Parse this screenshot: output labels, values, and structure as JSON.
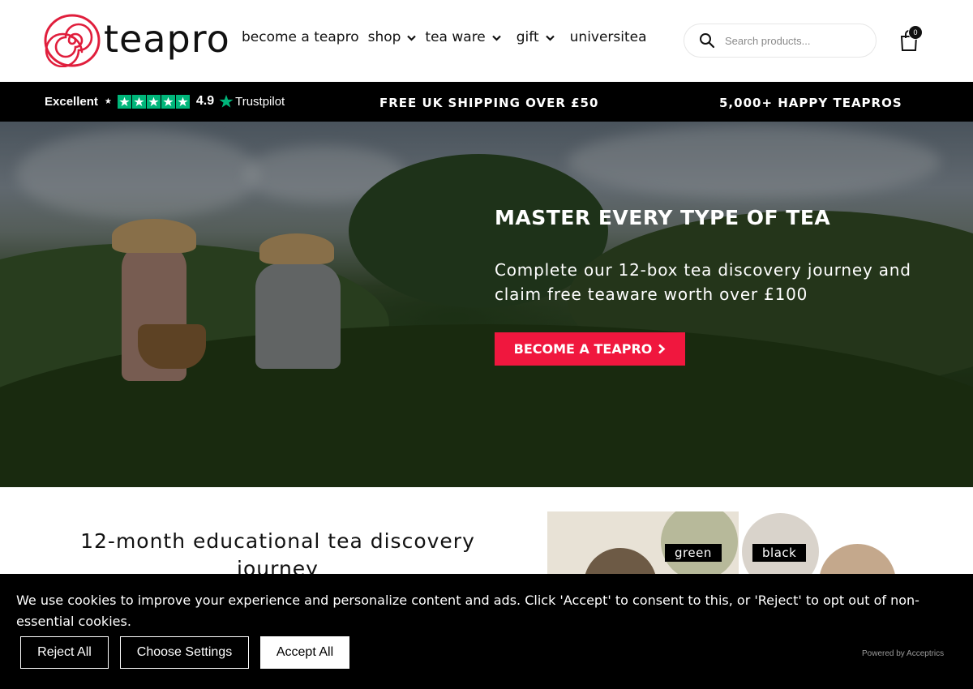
{
  "brand": {
    "name": "teapro",
    "accent": "#e01e3c"
  },
  "nav": {
    "items": [
      {
        "label": "become a teapro",
        "dropdown": false
      },
      {
        "label": "shop",
        "dropdown": true
      },
      {
        "label": "tea ware",
        "dropdown": true
      },
      {
        "label": "gift",
        "dropdown": true
      },
      {
        "label": "universitea",
        "dropdown": false
      }
    ]
  },
  "search": {
    "placeholder": "Search products..."
  },
  "cart": {
    "count": "0"
  },
  "trustbar": {
    "rating_word": "Excellent",
    "score": "4.9",
    "provider": "Trustpilot",
    "stars": 5,
    "star_color": "#00b67a",
    "shipping": "FREE UK SHIPPING OVER £50",
    "customers": "5,000+ HAPPY TEAPROS"
  },
  "hero": {
    "title": "MASTER EVERY TYPE OF TEA",
    "subtitle": "Complete our 12-box tea discovery journey and claim free teaware worth over £100",
    "cta": "BECOME A TEAPRO",
    "cta_color": "#f0173e"
  },
  "section": {
    "title": "12-month educational tea discovery journey",
    "tags": [
      "green",
      "black"
    ]
  },
  "cookie": {
    "message": "We use cookies to improve your experience and personalize content and ads. Click 'Accept' to consent to this, or 'Reject' to opt out of non-essential cookies.",
    "reject": "Reject All",
    "settings": "Choose Settings",
    "accept": "Accept All",
    "powered": "Powered by Acceptrics"
  }
}
